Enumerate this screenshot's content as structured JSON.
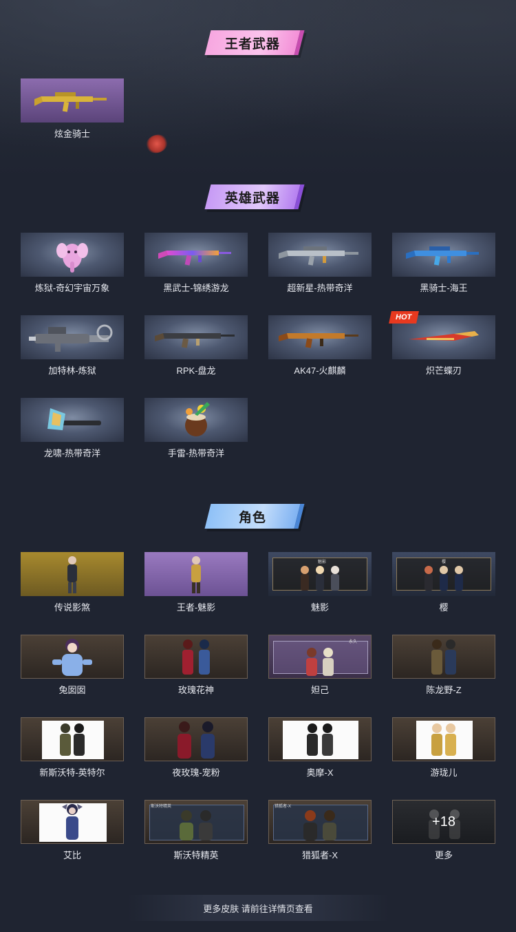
{
  "sections": {
    "king_weapons": {
      "title": "王者武器",
      "items": [
        {
          "label": "炫金骑士",
          "icon": "gold-rifle"
        }
      ]
    },
    "hero_weapons": {
      "title": "英雄武器",
      "items": [
        {
          "label": "炼狱-奇幻宇宙万象",
          "icon": "pink-elephant-grenade"
        },
        {
          "label": "黑武士-锦绣游龙",
          "icon": "rainbow-rifle"
        },
        {
          "label": "超新星-热带奇洋",
          "icon": "silver-rifle"
        },
        {
          "label": "黑骑士-海王",
          "icon": "blue-rifle"
        },
        {
          "label": "加特林-炼狱",
          "icon": "gatling-gun"
        },
        {
          "label": "RPK-盘龙",
          "icon": "rpk-rifle"
        },
        {
          "label": "AK47-火麒麟",
          "icon": "ak47-rifle"
        },
        {
          "label": "炽芒蝶刃",
          "icon": "butterfly-blade",
          "badge": "HOT"
        },
        {
          "label": "龙啸-热带奇洋",
          "icon": "axe"
        },
        {
          "label": "手雷-热带奇洋",
          "icon": "coconut-grenade"
        }
      ]
    },
    "characters": {
      "title": "角色",
      "items": [
        {
          "label": "传说影煞",
          "icon": "character-portrait"
        },
        {
          "label": "王者-魅影",
          "icon": "character-portrait"
        },
        {
          "label": "魅影",
          "icon": "character-group",
          "frame_text": "魅影"
        },
        {
          "label": "樱",
          "icon": "character-group",
          "frame_text": "樱"
        },
        {
          "label": "兔囡囡",
          "icon": "character-portrait"
        },
        {
          "label": "玫瑰花神",
          "icon": "character-pair"
        },
        {
          "label": "妲己",
          "icon": "character-pair",
          "frame_text": "永久"
        },
        {
          "label": "陈龙野-Z",
          "icon": "character-pair"
        },
        {
          "label": "新斯沃特-英特尔",
          "icon": "character-pair"
        },
        {
          "label": "夜玫瑰-宠粉",
          "icon": "character-pair"
        },
        {
          "label": "奥摩-X",
          "icon": "character-pair"
        },
        {
          "label": "游珑儿",
          "icon": "character-pair"
        },
        {
          "label": "艾比",
          "icon": "character-portrait"
        },
        {
          "label": "斯沃特精英",
          "icon": "character-pair",
          "frame_text": "斯沃特精英"
        },
        {
          "label": "猎狐者-X",
          "icon": "character-pair",
          "frame_text": "猎狐者-X"
        },
        {
          "label": "更多",
          "icon": "more-characters",
          "overlay": "+18"
        }
      ]
    }
  },
  "footer": {
    "text": "更多皮肤 请前往详情页查看"
  },
  "colors": {
    "background": "#1f2431",
    "hot_badge": "#e8391f",
    "banner_pink": "#f7a7e0",
    "banner_purple": "#c79bf5",
    "banner_blue": "#8fc1f7"
  }
}
